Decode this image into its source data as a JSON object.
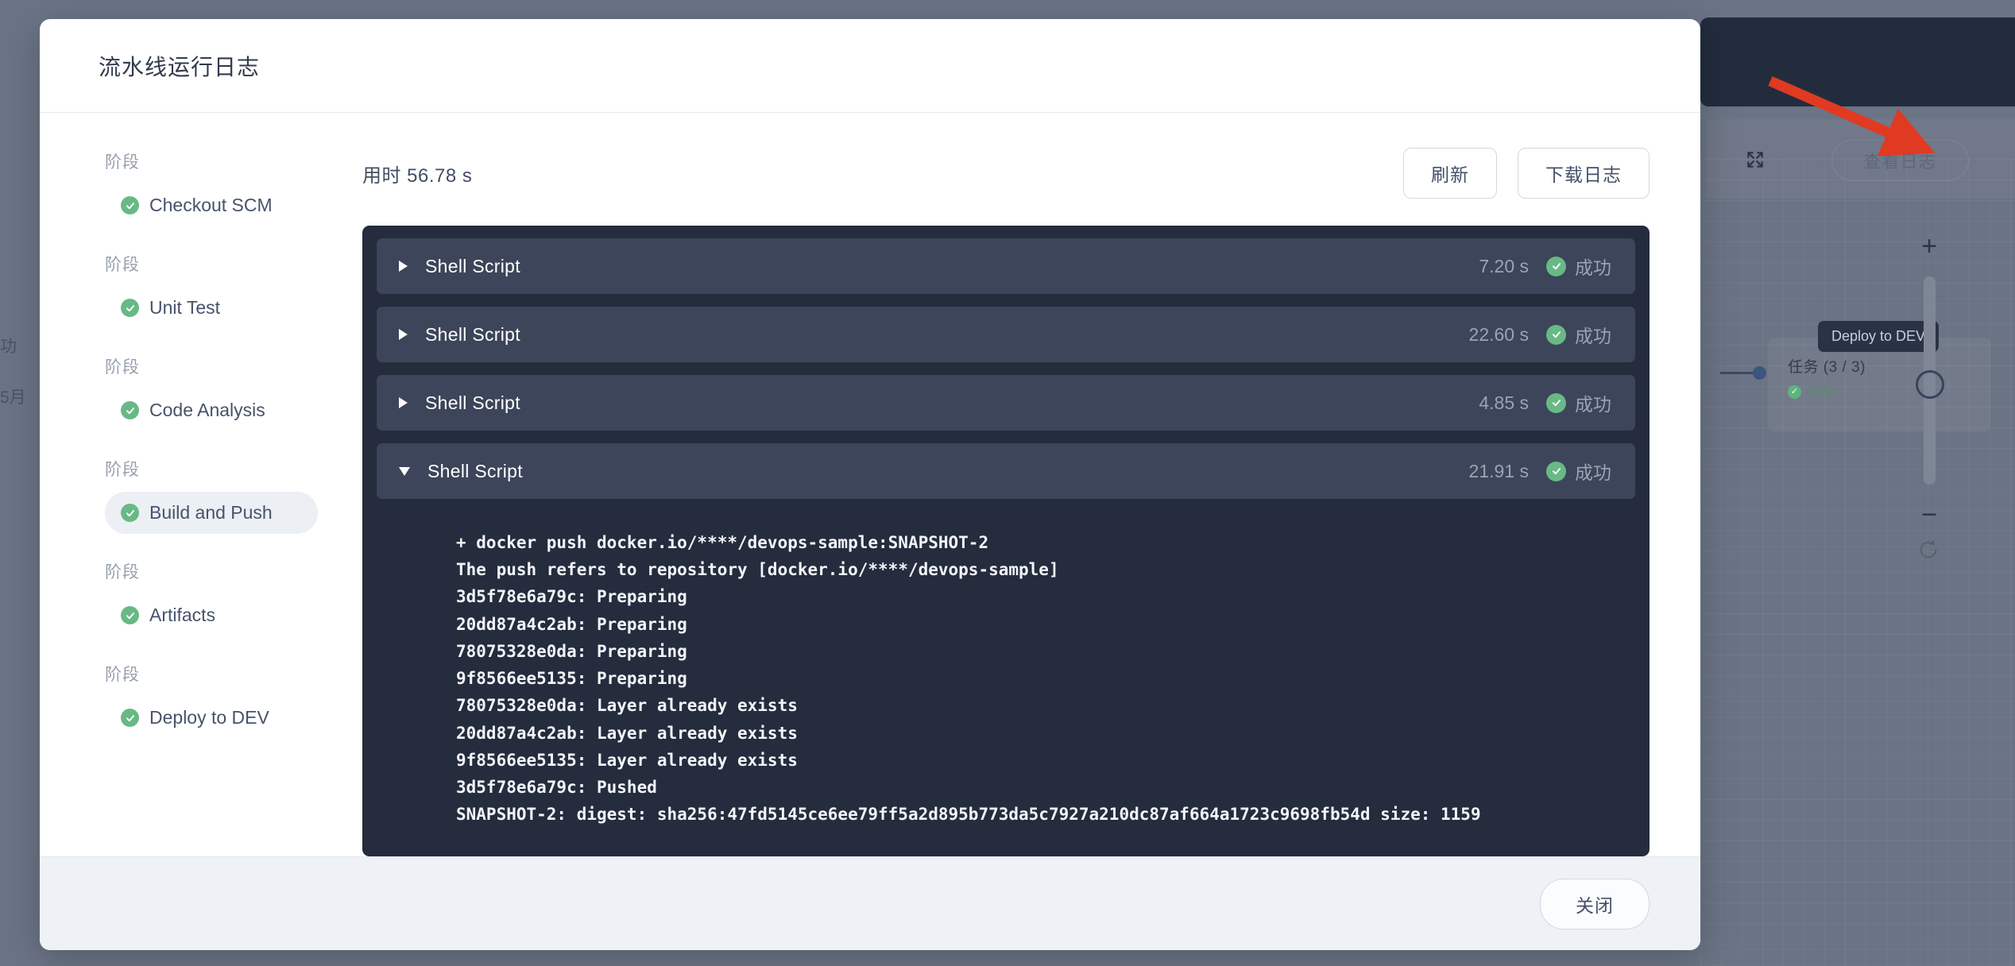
{
  "background": {
    "view_log_button": "查看日志",
    "expand_icon": "expand-arrows-icon",
    "tooltip_label": "Deploy to DEV",
    "node": {
      "title": "任务 (3 / 3)",
      "status": "成功"
    },
    "zoom_controls": {
      "plus": "+",
      "minus": "−",
      "reset_icon": "refresh-icon"
    },
    "left_fragments": [
      "功",
      "5月"
    ],
    "arrow": "red-pointer-arrow"
  },
  "modal": {
    "title": "流水线运行日志",
    "sidebar": {
      "stage_label": "阶段",
      "stages": [
        {
          "label": "Checkout SCM",
          "status": "success",
          "active": false
        },
        {
          "label": "Unit Test",
          "status": "success",
          "active": false
        },
        {
          "label": "Code Analysis",
          "status": "success",
          "active": false
        },
        {
          "label": "Build and Push",
          "status": "success",
          "active": true
        },
        {
          "label": "Artifacts",
          "status": "success",
          "active": false
        },
        {
          "label": "Deploy to DEV",
          "status": "success",
          "active": false
        }
      ]
    },
    "toolbar": {
      "elapsed": "用时 56.78 s",
      "refresh_label": "刷新",
      "download_label": "下载日志"
    },
    "steps": [
      {
        "name": "Shell Script",
        "duration": "7.20 s",
        "status": "成功",
        "expanded": false
      },
      {
        "name": "Shell Script",
        "duration": "22.60 s",
        "status": "成功",
        "expanded": false
      },
      {
        "name": "Shell Script",
        "duration": "4.85 s",
        "status": "成功",
        "expanded": false
      },
      {
        "name": "Shell Script",
        "duration": "21.91 s",
        "status": "成功",
        "expanded": true
      }
    ],
    "log_output": "+ docker push docker.io/****/devops-sample:SNAPSHOT-2\nThe push refers to repository [docker.io/****/devops-sample]\n3d5f78e6a79c: Preparing\n20dd87a4c2ab: Preparing\n78075328e0da: Preparing\n9f8566ee5135: Preparing\n78075328e0da: Layer already exists\n20dd87a4c2ab: Layer already exists\n9f8566ee5135: Layer already exists\n3d5f78e6a79c: Pushed\nSNAPSHOT-2: digest: sha256:47fd5145ce6ee79ff5a2d895b773da5c7927a210dc87af664a1723c9698fb54d size: 1159",
    "footer": {
      "close_label": "关闭"
    }
  },
  "colors": {
    "accent_success": "#68b986",
    "console_bg": "#242c3d",
    "row_bg": "#3c4559",
    "arrow_red": "#e03a22",
    "backdrop": "#6b7485"
  }
}
